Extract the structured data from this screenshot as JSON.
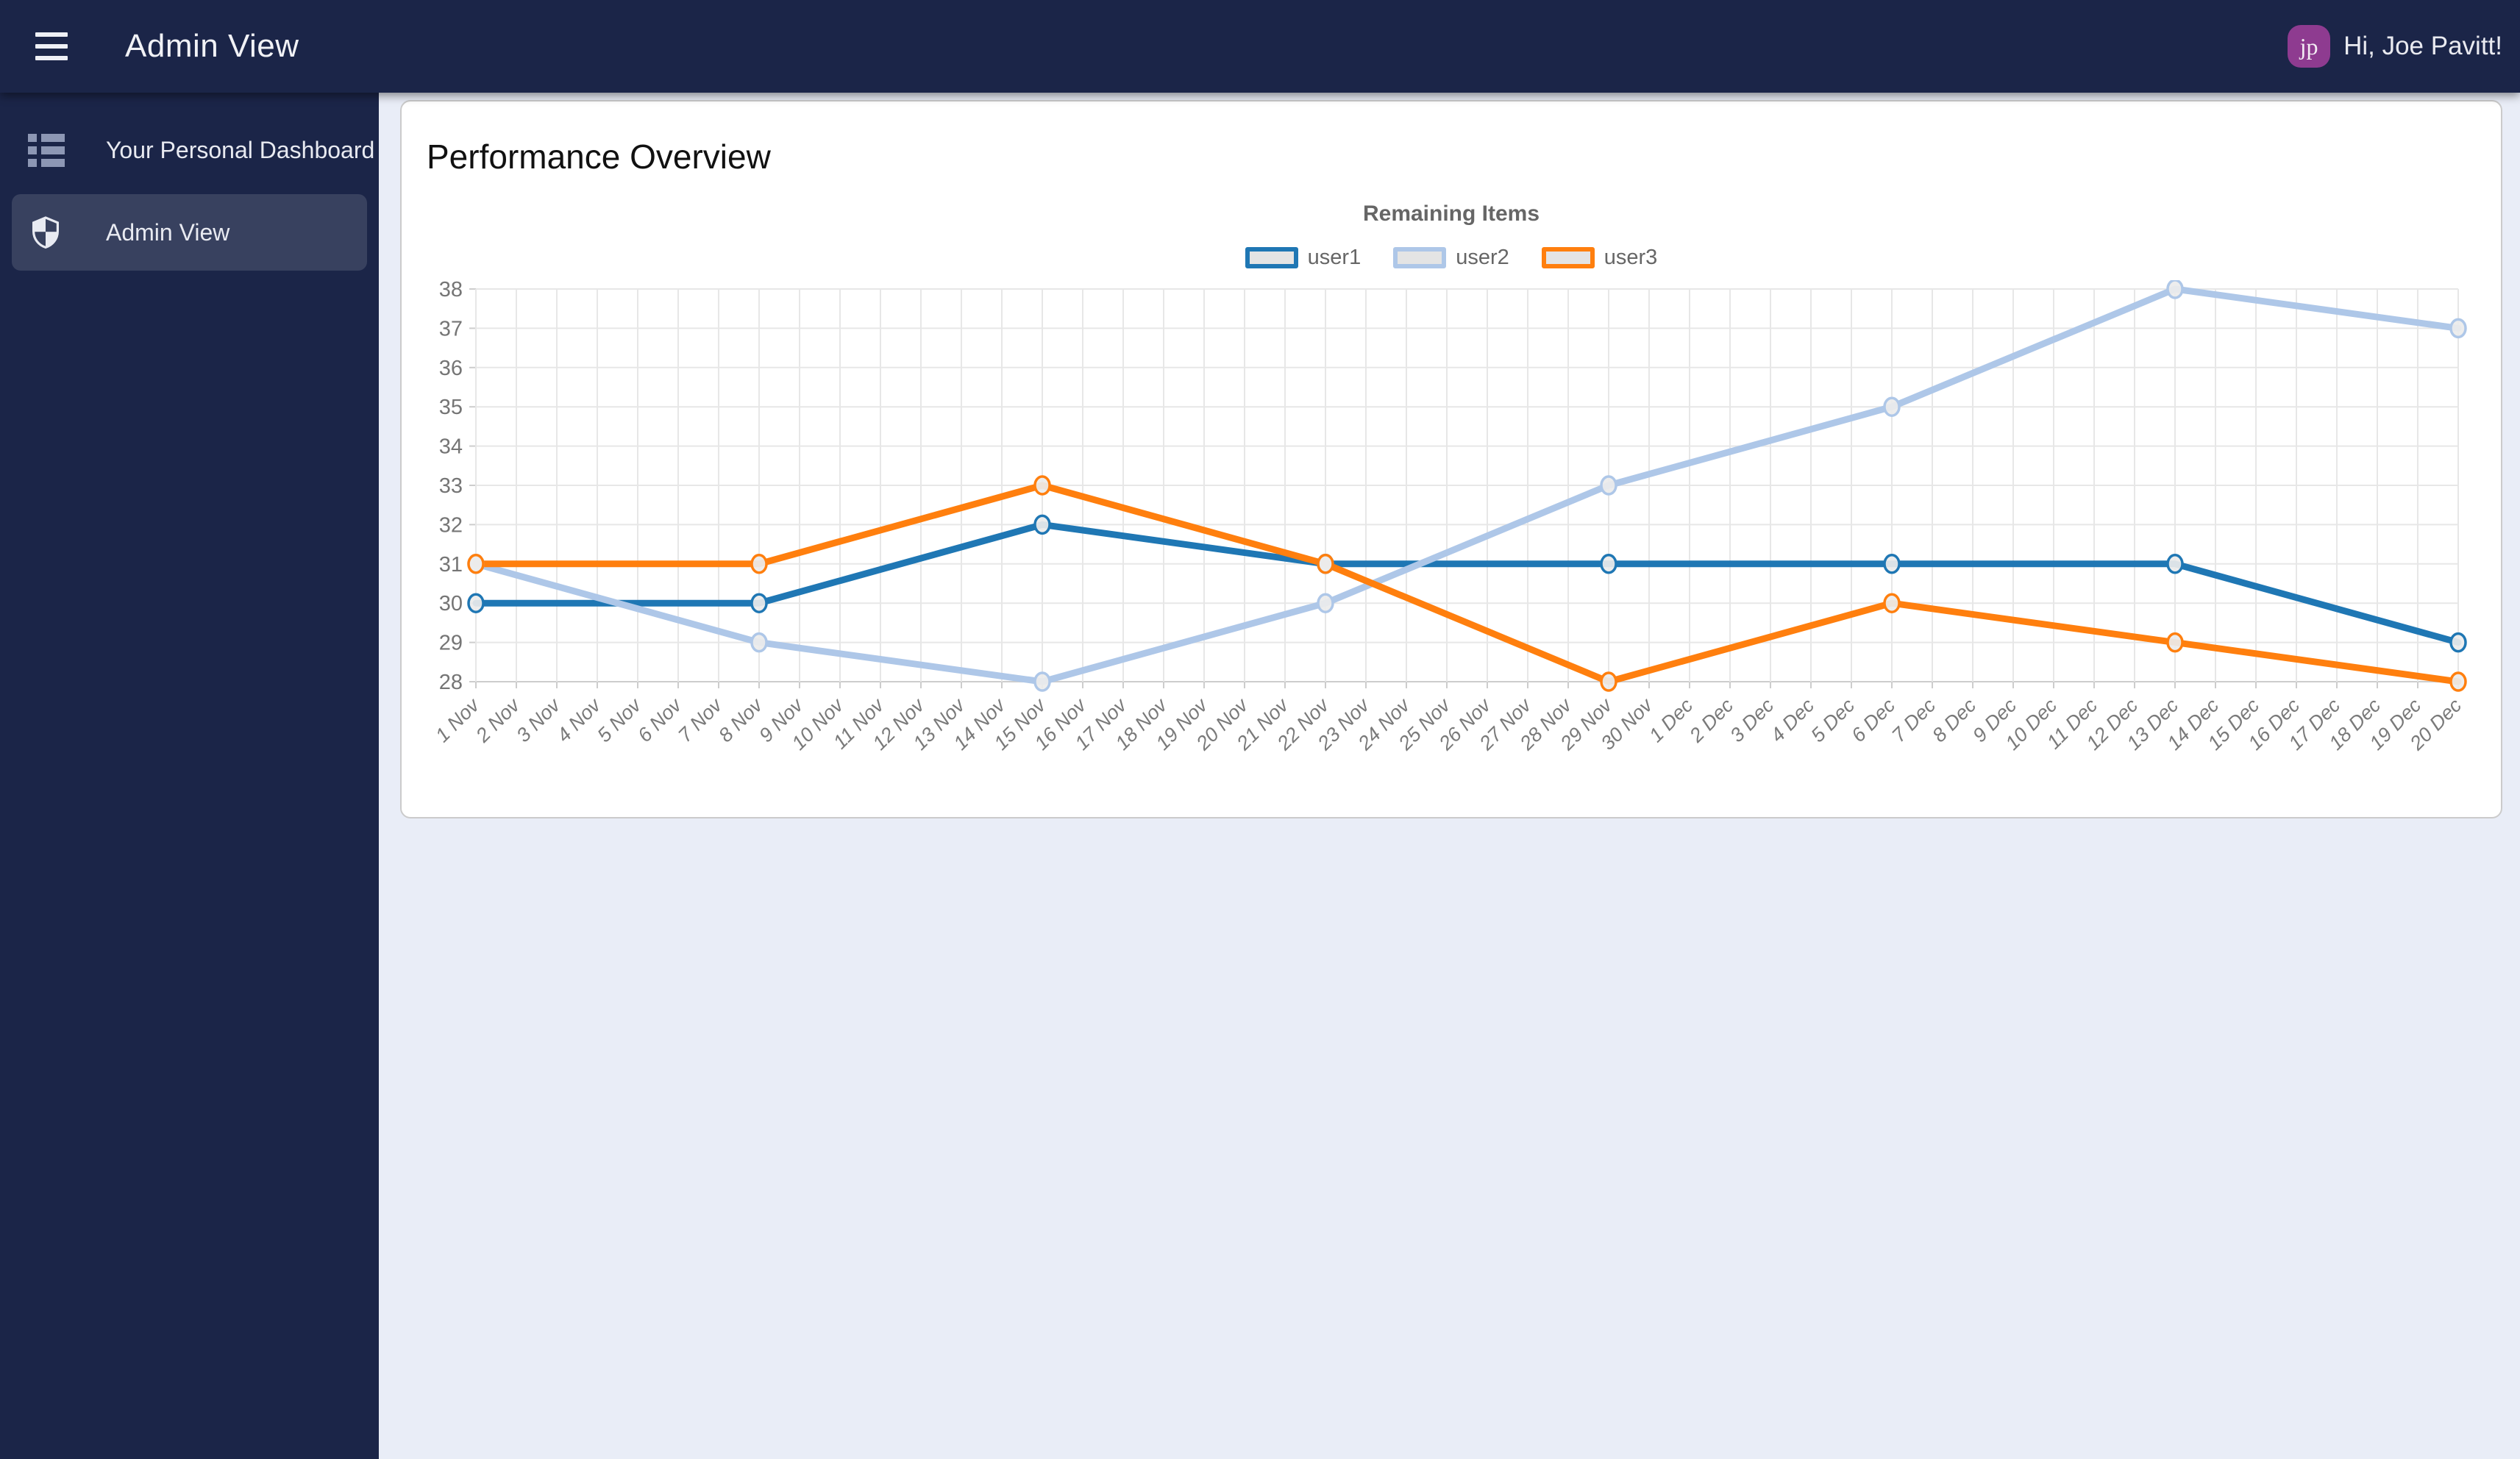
{
  "topbar": {
    "title": "Admin View",
    "greeting": "Hi, Joe Pavitt!",
    "avatar_initials": "jp",
    "bg_color": "#1b2548",
    "avatar_color": "#8e3b90"
  },
  "sidebar": {
    "items": [
      {
        "label": "Your Personal Dashboard",
        "icon": "dashboard-list-icon",
        "active": false
      },
      {
        "label": "Admin View",
        "icon": "shield-icon",
        "active": true
      }
    ]
  },
  "main": {
    "card_title": "Performance Overview"
  },
  "chart_data": {
    "type": "line",
    "title": "Remaining Items",
    "legend_position": "top",
    "grid": true,
    "ylim": [
      28,
      38
    ],
    "y_ticks": [
      28,
      29,
      30,
      31,
      32,
      33,
      34,
      35,
      36,
      37,
      38
    ],
    "x_labels": [
      "1 Nov",
      "2 Nov",
      "3 Nov",
      "4 Nov",
      "5 Nov",
      "6 Nov",
      "7 Nov",
      "8 Nov",
      "9 Nov",
      "10 Nov",
      "11 Nov",
      "12 Nov",
      "13 Nov",
      "14 Nov",
      "15 Nov",
      "16 Nov",
      "17 Nov",
      "18 Nov",
      "19 Nov",
      "20 Nov",
      "21 Nov",
      "22 Nov",
      "23 Nov",
      "24 Nov",
      "25 Nov",
      "26 Nov",
      "27 Nov",
      "28 Nov",
      "29 Nov",
      "30 Nov",
      "1 Dec",
      "2 Dec",
      "3 Dec",
      "4 Dec",
      "5 Dec",
      "6 Dec",
      "7 Dec",
      "8 Dec",
      "9 Dec",
      "10 Dec",
      "11 Dec",
      "12 Dec",
      "13 Dec",
      "14 Dec",
      "15 Dec",
      "16 Dec",
      "17 Dec",
      "18 Dec",
      "19 Dec",
      "20 Dec"
    ],
    "series": [
      {
        "name": "user1",
        "color": "#1f77b4",
        "points": [
          {
            "x": "1 Nov",
            "y": 30
          },
          {
            "x": "8 Nov",
            "y": 30
          },
          {
            "x": "15 Nov",
            "y": 32
          },
          {
            "x": "22 Nov",
            "y": 31
          },
          {
            "x": "29 Nov",
            "y": 31
          },
          {
            "x": "6 Dec",
            "y": 31
          },
          {
            "x": "13 Dec",
            "y": 31
          },
          {
            "x": "20 Dec",
            "y": 29
          }
        ]
      },
      {
        "name": "user2",
        "color": "#aec7e8",
        "points": [
          {
            "x": "1 Nov",
            "y": 31
          },
          {
            "x": "8 Nov",
            "y": 29
          },
          {
            "x": "15 Nov",
            "y": 28
          },
          {
            "x": "22 Nov",
            "y": 30
          },
          {
            "x": "29 Nov",
            "y": 33
          },
          {
            "x": "6 Dec",
            "y": 35
          },
          {
            "x": "13 Dec",
            "y": 38
          },
          {
            "x": "20 Dec",
            "y": 37
          }
        ]
      },
      {
        "name": "user3",
        "color": "#ff7f0e",
        "points": [
          {
            "x": "1 Nov",
            "y": 31
          },
          {
            "x": "8 Nov",
            "y": 31
          },
          {
            "x": "15 Nov",
            "y": 33
          },
          {
            "x": "22 Nov",
            "y": 31
          },
          {
            "x": "29 Nov",
            "y": 28
          },
          {
            "x": "6 Dec",
            "y": 30
          },
          {
            "x": "13 Dec",
            "y": 29
          },
          {
            "x": "20 Dec",
            "y": 28
          }
        ]
      }
    ]
  }
}
